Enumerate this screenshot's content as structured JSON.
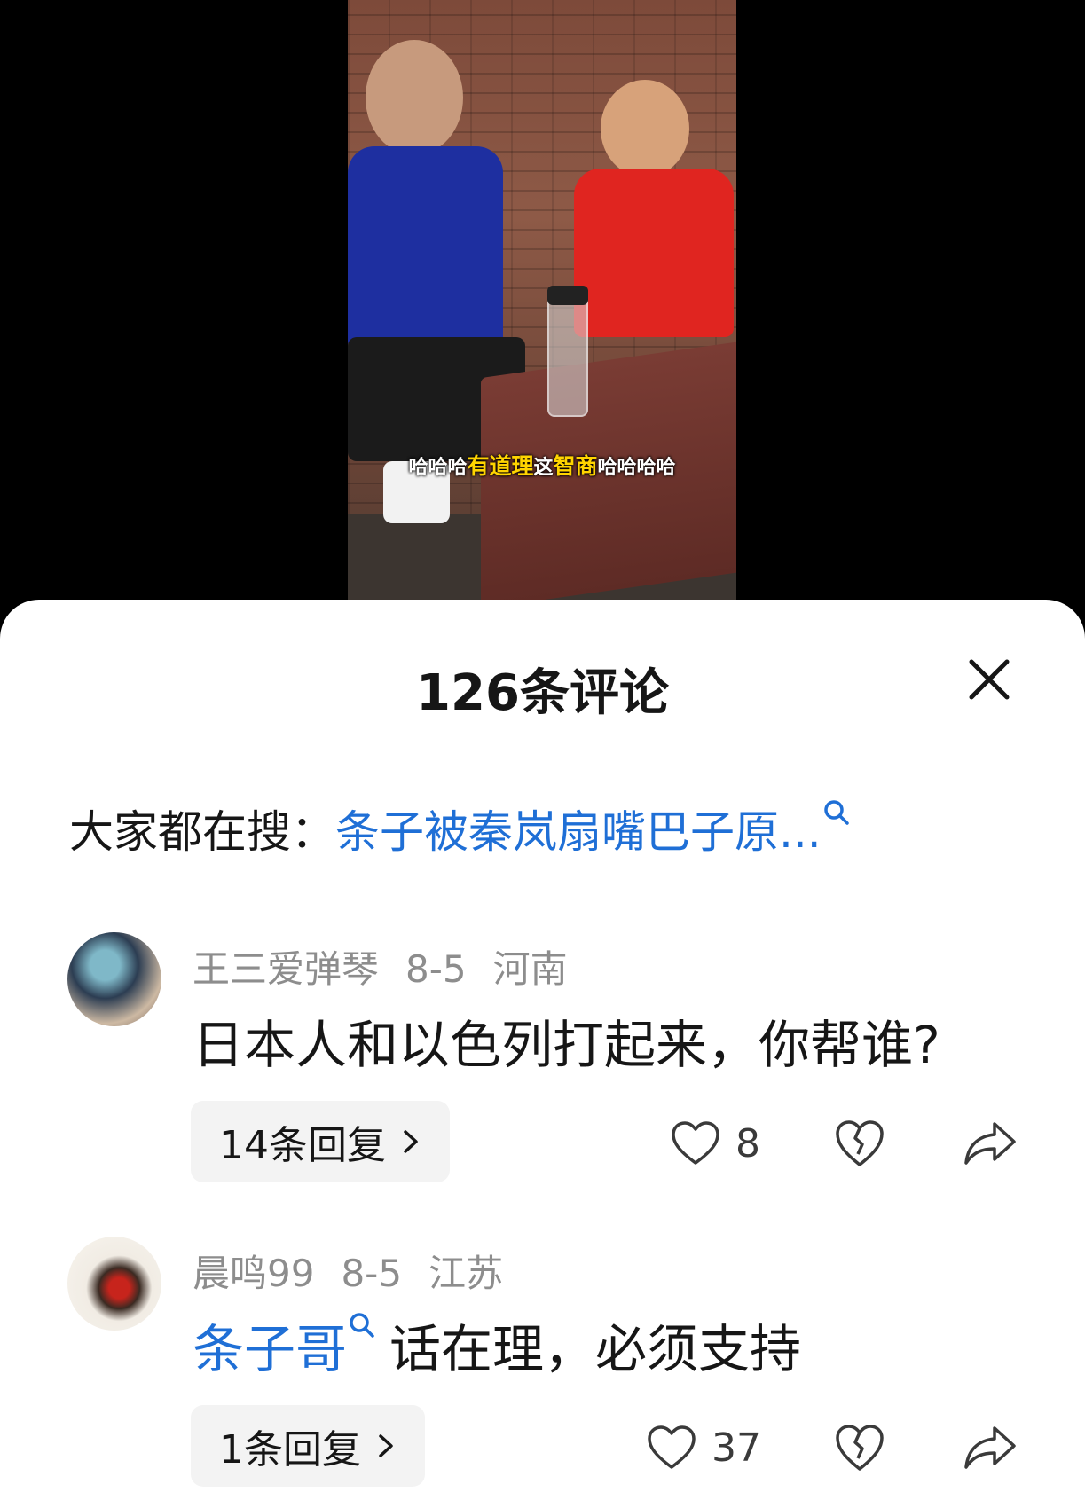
{
  "video": {
    "caption": {
      "part1": "哈哈哈",
      "part2": "有道理",
      "part3": "这",
      "part4": "智商",
      "part5": "哈哈哈哈"
    }
  },
  "panel": {
    "title": "126条评论",
    "close_icon": "close-icon"
  },
  "trending": {
    "label": "大家都在搜：",
    "query": "条子被秦岚扇嘴巴子原...",
    "icon": "search-icon"
  },
  "comments": [
    {
      "username": "王三爱弹琴",
      "date": "8-5",
      "location": "河南",
      "text": "日本人和以色列打起来，你帮谁?",
      "replies_label": "14条回复",
      "likes": "8"
    },
    {
      "username": "晨鸣99",
      "date": "8-5",
      "location": "江苏",
      "tag": "条子哥",
      "text": "话在理，必须支持",
      "replies_label": "1条回复",
      "likes": "37"
    }
  ],
  "colors": {
    "link": "#1f6fd6",
    "text": "#161616",
    "meta": "#8d8d8d"
  }
}
